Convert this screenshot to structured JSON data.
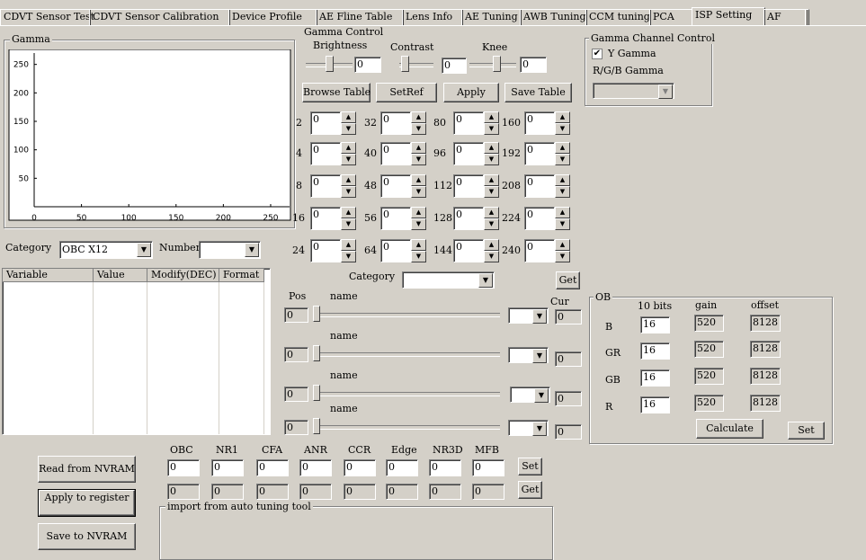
{
  "tabs": [
    {
      "label": "CDVT Sensor Test",
      "active": false
    },
    {
      "label": "CDVT Sensor Calibration",
      "active": false
    },
    {
      "label": "Device Profile",
      "active": false
    },
    {
      "label": "AE Fline Table",
      "active": false
    },
    {
      "label": "Lens Info",
      "active": false
    },
    {
      "label": "AE Tuning",
      "active": false
    },
    {
      "label": "AWB Tuning",
      "active": false
    },
    {
      "label": "CCM tuning",
      "active": false
    },
    {
      "label": "PCA",
      "active": false
    },
    {
      "label": "ISP Setting",
      "active": true
    },
    {
      "label": "AF",
      "active": false
    }
  ],
  "gamma_chart": {
    "group_label": "Gamma",
    "chart_data": {
      "type": "line",
      "title": "",
      "xlabel": "",
      "ylabel": "",
      "x_ticks": [
        "0",
        "50",
        "100",
        "150",
        "200",
        "250"
      ],
      "y_ticks": [
        "250",
        "200",
        "150",
        "100",
        "50"
      ],
      "xlim": [
        0,
        270
      ],
      "ylim": [
        0,
        270
      ],
      "series": []
    }
  },
  "gamma_control": {
    "group_label": "Gamma Control",
    "brightness_label": "Brightness",
    "brightness_value": "0",
    "contrast_label": "Contrast",
    "contrast_value": "0",
    "knee_label": "Knee",
    "knee_value": "0",
    "buttons": [
      "Browse Table",
      "SetRef",
      "Apply",
      "Save Table"
    ]
  },
  "gamma_channel": {
    "group_label": "Gamma Channel Control",
    "y_gamma_label": "Y Gamma",
    "y_gamma_checked": true,
    "rgb_gamma_label": "R/G/B Gamma",
    "rgb_select_value": ""
  },
  "gamma_points": [
    {
      "label": "2",
      "value": "0"
    },
    {
      "label": "32",
      "value": "0"
    },
    {
      "label": "80",
      "value": "0"
    },
    {
      "label": "160",
      "value": "0"
    },
    {
      "label": "4",
      "value": "0"
    },
    {
      "label": "40",
      "value": "0"
    },
    {
      "label": "96",
      "value": "0"
    },
    {
      "label": "192",
      "value": "0"
    },
    {
      "label": "8",
      "value": "0"
    },
    {
      "label": "48",
      "value": "0"
    },
    {
      "label": "112",
      "value": "0"
    },
    {
      "label": "208",
      "value": "0"
    },
    {
      "label": "16",
      "value": "0"
    },
    {
      "label": "56",
      "value": "0"
    },
    {
      "label": "128",
      "value": "0"
    },
    {
      "label": "224",
      "value": "0"
    },
    {
      "label": "24",
      "value": "0"
    },
    {
      "label": "64",
      "value": "0"
    },
    {
      "label": "144",
      "value": "0"
    },
    {
      "label": "240",
      "value": "0"
    }
  ],
  "category_select": {
    "label": "Category",
    "value": "OBC    X12",
    "number_label": "Number",
    "number_value": ""
  },
  "variable_table": {
    "headers": [
      "Variable",
      "Value",
      "Modify(DEC)",
      "Format"
    ],
    "rows": []
  },
  "tuning": {
    "category_label": "Category",
    "category_value": "",
    "get_label": "Get",
    "pos_label": "Pos",
    "cur_label": "Cur",
    "sliders": [
      {
        "pos": "0",
        "name": "name",
        "select": "",
        "cur": "0"
      },
      {
        "pos": "0",
        "name": "name",
        "select": "",
        "cur": "0"
      },
      {
        "pos": "0",
        "name": "name",
        "select": "",
        "cur": "0"
      },
      {
        "pos": "0",
        "name": "name",
        "select": "",
        "cur": "0"
      }
    ]
  },
  "ob": {
    "group_label": "OB",
    "col_bits": "10 bits",
    "col_gain": "gain",
    "col_offset": "offset",
    "rows": [
      {
        "name": "B",
        "bits": "16",
        "gain": "520",
        "offset": "8128"
      },
      {
        "name": "GR",
        "bits": "16",
        "gain": "520",
        "offset": "8128"
      },
      {
        "name": "GB",
        "bits": "16",
        "gain": "520",
        "offset": "8128"
      },
      {
        "name": "R",
        "bits": "16",
        "gain": "520",
        "offset": "8128"
      }
    ],
    "calculate_label": "Calculate",
    "set_label": "Set"
  },
  "nvram": {
    "read_label": "Read from NVRAM",
    "apply_label": "Apply to register",
    "save_label": "Save to NVRAM"
  },
  "modules": {
    "labels": [
      "OBC",
      "NR1",
      "CFA",
      "ANR",
      "CCR",
      "Edge",
      "NR3D",
      "MFB"
    ],
    "set_values": [
      "0",
      "0",
      "0",
      "0",
      "0",
      "0",
      "0",
      "0"
    ],
    "get_values": [
      "0",
      "0",
      "0",
      "0",
      "0",
      "0",
      "0",
      "0"
    ],
    "set_label": "Set",
    "get_label": "Get"
  },
  "import_group": {
    "label": "import from auto tuning tool"
  }
}
